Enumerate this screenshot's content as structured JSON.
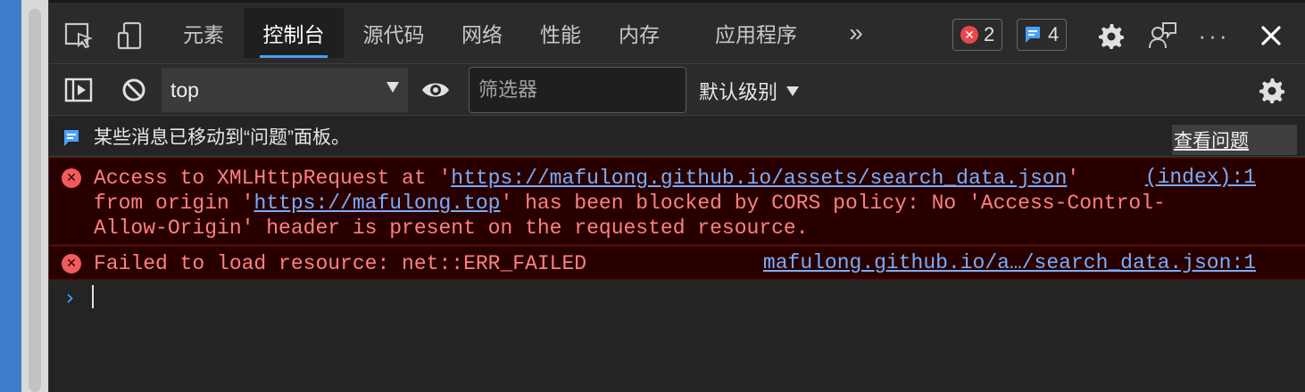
{
  "tabs": [
    {
      "label": "元素"
    },
    {
      "label": "控制台",
      "active": true
    },
    {
      "label": "源代码"
    },
    {
      "label": "网络"
    },
    {
      "label": "性能"
    },
    {
      "label": "内存"
    },
    {
      "label": "应用程序"
    }
  ],
  "more_tabs_label": "»",
  "badges": {
    "errors": "2",
    "issues": "4"
  },
  "toolbar": {
    "context": "top",
    "filter_placeholder": "筛选器",
    "levels_label": "默认级别"
  },
  "info_message": {
    "text": "某些消息已移动到“问题”面板。",
    "button_label": "查看问题"
  },
  "errors": [
    {
      "pre": "Access to XMLHttpRequest at '",
      "link1": "https://mafulong.github.io/assets/search_data.json",
      "mid1": "'",
      "source": "(index):1",
      "line2_pre": "from origin '",
      "link2": "https://mafulong.top",
      "line2_post": "' has been blocked by CORS policy: No 'Access-Control-",
      "line3": "Allow-Origin' header is present on the requested resource."
    },
    {
      "text": "Failed to load resource: net::ERR_FAILED",
      "source": "mafulong.github.io/a…/search_data.json:1"
    }
  ],
  "colors": {
    "accent": "#4aa0ff",
    "error_bg": "#290000",
    "error_text": "#ff8080",
    "link": "#7cacf8"
  },
  "icons": [
    "inspect-icon",
    "device-icon",
    "more-tabs-icon",
    "error-icon",
    "issue-icon",
    "settings-icon",
    "feedback-icon",
    "more-options-icon",
    "close-icon",
    "sidebar-toggle-icon",
    "clear-console-icon",
    "live-expression-icon",
    "console-settings-icon",
    "info-message-icon",
    "prompt-chevron-icon"
  ]
}
